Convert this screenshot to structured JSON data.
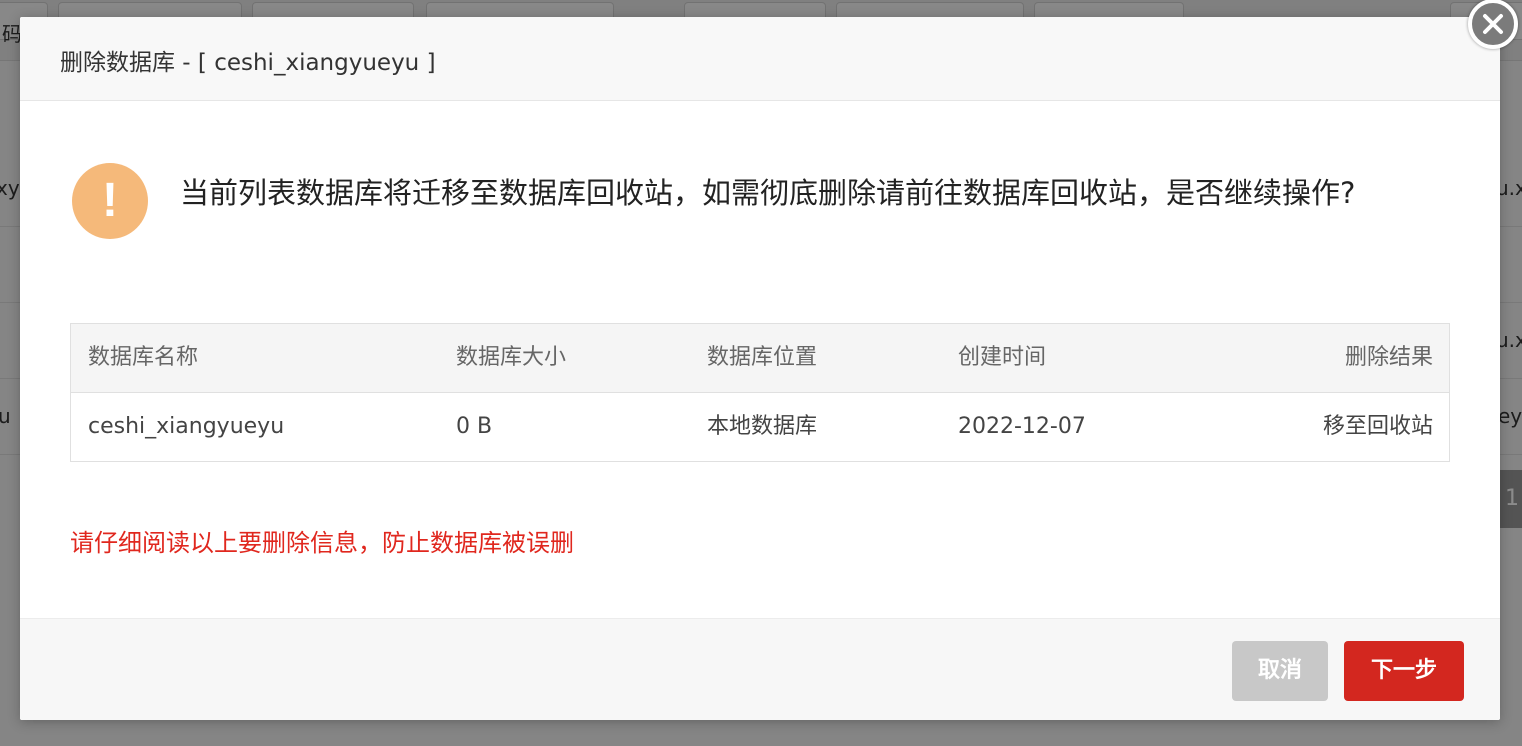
{
  "background": {
    "top_left_char": "码",
    "row_fragments": [
      {
        "left": "xy",
        "right": "u.x"
      },
      {
        "left": "",
        "right": "u.x"
      },
      {
        "left": "u",
        "right": "ey"
      }
    ],
    "pager_number": "1"
  },
  "dialog": {
    "title": "删除数据库 - [ ceshi_xiangyueyu ]",
    "warning_icon_glyph": "!",
    "message": "当前列表数据库将迁移至数据库回收站，如需彻底删除请前往数据库回收站，是否继续操作?",
    "table": {
      "headers": [
        "数据库名称",
        "数据库大小",
        "数据库位置",
        "创建时间",
        "删除结果"
      ],
      "rows": [
        [
          "ceshi_xiangyueyu",
          "0 B",
          "本地数据库",
          "2022-12-07",
          "移至回收站"
        ]
      ]
    },
    "caution": "请仔细阅读以上要删除信息，防止数据库被误删",
    "buttons": {
      "cancel": "取消",
      "next": "下一步"
    },
    "colors": {
      "primary": "#d3271f",
      "warning_icon": "#f5b97a",
      "caution_text": "#e0271e"
    }
  }
}
